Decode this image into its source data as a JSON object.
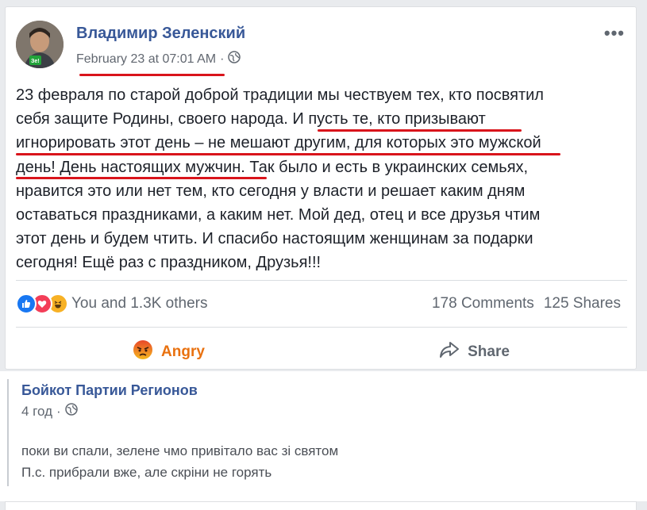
{
  "post": {
    "author": "Владимир Зеленский",
    "timestamp": "February 23 at 07:01 AM",
    "separator": "·",
    "privacy_icon": "globe-icon",
    "more_icon": "more-options-icon",
    "avatar_badge": "Зе!",
    "text_lines": [
      "23 февраля по старой доброй традиции мы чествуем тех, кто посвятил",
      "себя защите Родины, своего народа. И пусть те, кто призывают",
      "игнорировать этот день – не мешают другим, для которых это мужской",
      "день! День настоящих мужчин. Так было и есть в украинских семьях,",
      "нравится это или нет тем, кто сегодня у власти и решает каким дням",
      "оставаться праздниками, а каким нет. Мой дед, отец и все друзья чтим",
      "этот день и будем чтить. И спасибо настоящим женщинам за подарки",
      "сегодня! Ещё раз с праздником, Друзья!!!"
    ],
    "reactions_summary": "You and 1.3K others",
    "reaction_icons": [
      "like-icon",
      "love-icon",
      "haha-icon"
    ],
    "comments_count": "178 Comments",
    "shares_count": "125 Shares",
    "actions": {
      "angry": "Angry",
      "share": "Share"
    },
    "colors": {
      "link": "#385898",
      "angry": "#e9710f",
      "underline": "#d9141b",
      "like": "#1877f2",
      "love": "#f33e58",
      "haha": "#f7b125"
    }
  },
  "comment": {
    "author": "Бойкот Партии Регионов",
    "time": "4 год",
    "separator": "·",
    "lines": [
      "поки ви спали, зелене чмо привітало вас зі святом",
      "П.с. прибрали вже, але скріни не горять"
    ]
  }
}
